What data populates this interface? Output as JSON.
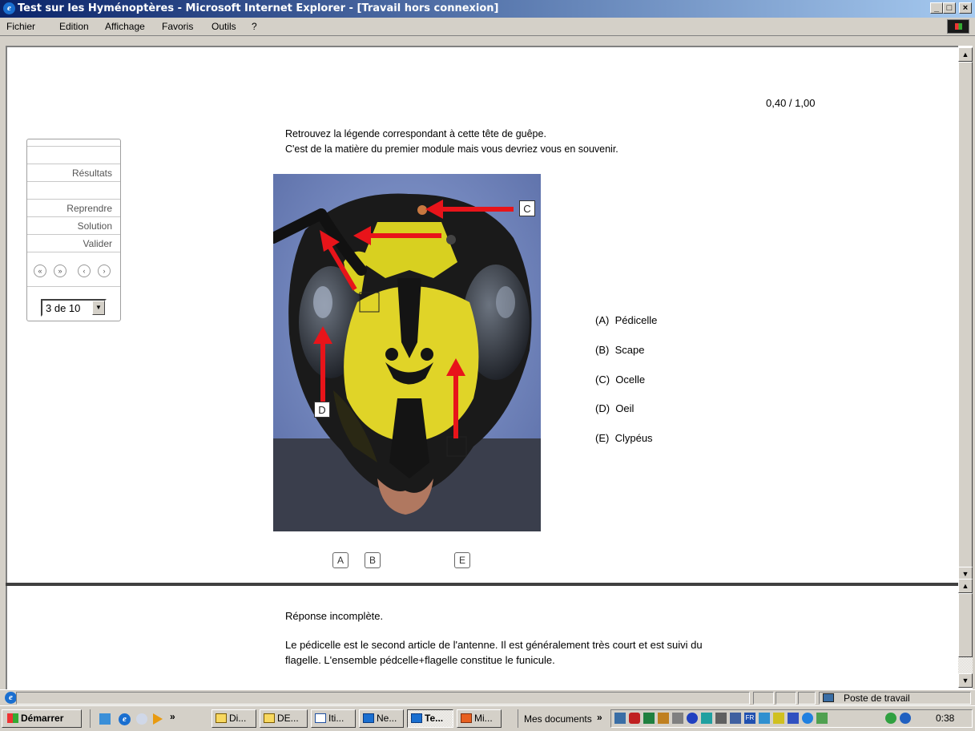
{
  "window": {
    "title": "Test sur les Hyménoptères - Microsoft Internet Explorer - [Travail hors connexion]",
    "controls": [
      "_",
      "□",
      "×"
    ]
  },
  "menu": [
    "Fichier",
    "Edition",
    "Affichage",
    "Favoris",
    "Outils",
    "?"
  ],
  "score": "0,40 / 1,00",
  "nav": {
    "items": {
      "resultats": "Résultats",
      "reprendre": "Reprendre",
      "solution": "Solution",
      "valider": "Valider"
    },
    "icons": [
      "«",
      "»",
      "‹",
      "›"
    ],
    "page_select": "3 de 10"
  },
  "question": {
    "line1": "Retrouvez la légende correspondant à cette tête de guêpe.",
    "line2": "C'est de la matière du premier module mais vous devriez vous en souvenir.",
    "image_labels": {
      "c": "C",
      "d": "D"
    },
    "choices": [
      {
        "key": "(A)",
        "label": "Pédicelle"
      },
      {
        "key": "(B)",
        "label": "Scape"
      },
      {
        "key": "(C)",
        "label": "Ocelle"
      },
      {
        "key": "(D)",
        "label": "Oeil"
      },
      {
        "key": "(E)",
        "label": "Clypéus"
      }
    ],
    "answers": {
      "a": "A",
      "b": "B",
      "e": "E"
    }
  },
  "feedback": {
    "status": "Réponse incomplète.",
    "line1": "Le pédicelle est le second article de l'antenne. Il est généralement très court et est suivi du",
    "line2": "flagelle. L'ensemble pédcelle+flagelle constitue le funicule."
  },
  "statusbar": {
    "zone": "Poste de travail"
  },
  "taskbar": {
    "start": "Démarrer",
    "tasks": [
      "Di...",
      "DE...",
      "Iti...",
      "Ne...",
      "Te...",
      "Mi..."
    ],
    "active_task": "Te...",
    "docs": "Mes documents",
    "chevron": "»",
    "clock": "0:38"
  },
  "colors": {
    "titlebar_start": "#0a246a",
    "titlebar_end": "#a6caf0",
    "chrome": "#d4d0c8",
    "arrow": "#e8141a"
  }
}
